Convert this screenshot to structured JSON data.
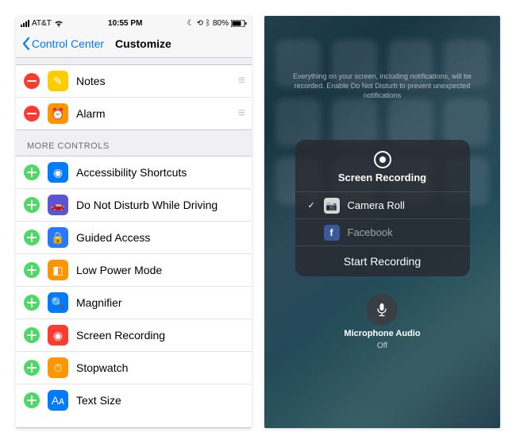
{
  "statusBar": {
    "carrier": "AT&T",
    "time": "10:55 PM",
    "battery": "80%"
  },
  "nav": {
    "back": "Control Center",
    "title": "Customize"
  },
  "included": [
    {
      "label": "Notes",
      "iconBg": "#ffcc00",
      "glyph": "✎"
    },
    {
      "label": "Alarm",
      "iconBg": "#ff9500",
      "glyph": "⏰"
    }
  ],
  "moreHeader": "MORE CONTROLS",
  "more": [
    {
      "label": "Accessibility Shortcuts",
      "iconBg": "#007aff",
      "glyph": "◉"
    },
    {
      "label": "Do Not Disturb While Driving",
      "iconBg": "#5856d6",
      "glyph": "🚗"
    },
    {
      "label": "Guided Access",
      "iconBg": "#277aff",
      "glyph": "🔒"
    },
    {
      "label": "Low Power Mode",
      "iconBg": "#ff9500",
      "glyph": "◧"
    },
    {
      "label": "Magnifier",
      "iconBg": "#007aff",
      "glyph": "🔍"
    },
    {
      "label": "Screen Recording",
      "iconBg": "#ff3b30",
      "glyph": "◉"
    },
    {
      "label": "Stopwatch",
      "iconBg": "#ff9500",
      "glyph": "⏱"
    },
    {
      "label": "Text Size",
      "iconBg": "#007aff",
      "glyph": "Aᴀ"
    }
  ],
  "recNotice": "Everything on your screen, including notifications, will be recorded. Enable Do Not Disturb to prevent unexpected notifications",
  "panel": {
    "title": "Screen Recording",
    "options": [
      {
        "label": "Camera Roll",
        "selected": true,
        "iconBg": "#d8d8d8",
        "glyph": "📷"
      },
      {
        "label": "Facebook",
        "selected": false,
        "iconBg": "#3b5998",
        "glyph": "f"
      }
    ],
    "action": "Start Recording"
  },
  "mic": {
    "label": "Microphone Audio",
    "state": "Off"
  }
}
